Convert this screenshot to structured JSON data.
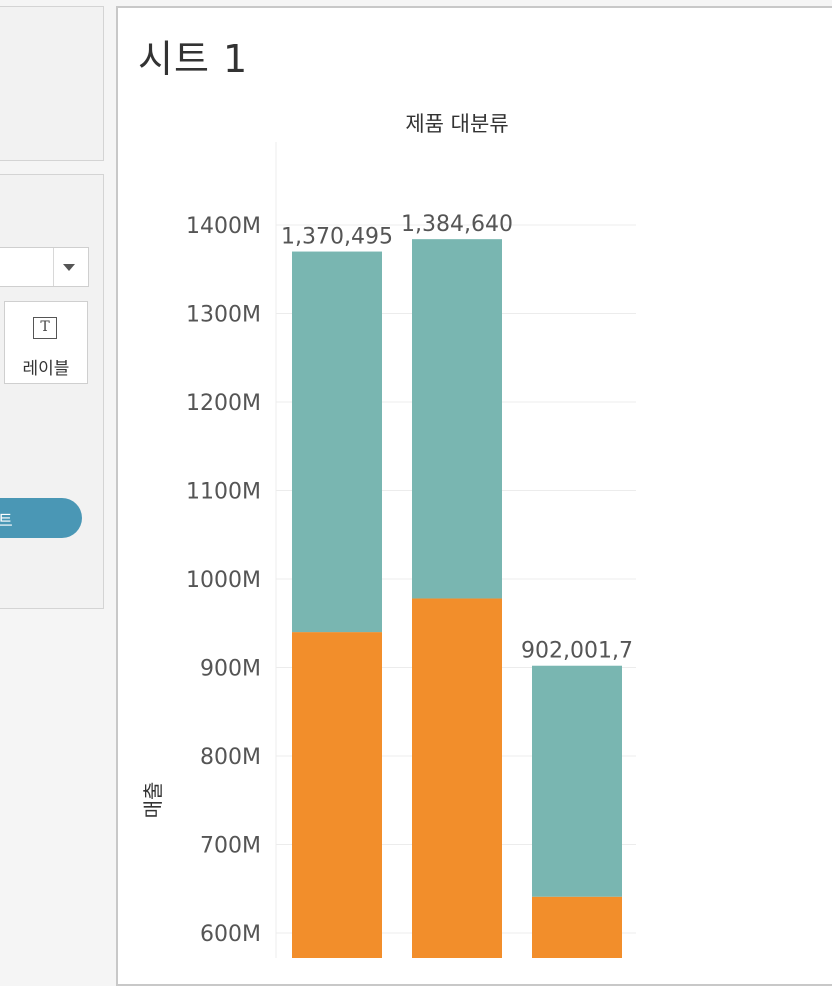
{
  "sheet": {
    "title": "시트 1"
  },
  "marks_card": {
    "label_button": "레이블",
    "label_icon_glyph": "T",
    "pill_fragment": "트"
  },
  "colors": {
    "segment_upper": "#79b6b1",
    "segment_lower": "#f28e2b",
    "pill": "#4a97b5",
    "gridline": "#ececec"
  },
  "chart_data": {
    "type": "bar",
    "stacked": true,
    "column_header": "제품 대분류",
    "ylabel": "매출",
    "ylim": [
      600000000,
      1450000000
    ],
    "yticks": [
      {
        "value": 600000000,
        "label": "600M"
      },
      {
        "value": 700000000,
        "label": "700M"
      },
      {
        "value": 800000000,
        "label": "800M"
      },
      {
        "value": 900000000,
        "label": "900M"
      },
      {
        "value": 1000000000,
        "label": "1000M"
      },
      {
        "value": 1100000000,
        "label": "1100M"
      },
      {
        "value": 1200000000,
        "label": "1200M"
      },
      {
        "value": 1300000000,
        "label": "1300M"
      },
      {
        "value": 1400000000,
        "label": "1400M"
      }
    ],
    "grid": true,
    "bars": [
      {
        "segments": [
          940000000,
          430000000
        ],
        "total": 1370495000,
        "label": "1,370,495"
      },
      {
        "segments": [
          978000000,
          406000000
        ],
        "total": 1384640000,
        "label": "1,384,640"
      },
      {
        "segments": [
          641000000,
          261000000
        ],
        "total": 902001000,
        "label": "902,001,7"
      }
    ]
  }
}
